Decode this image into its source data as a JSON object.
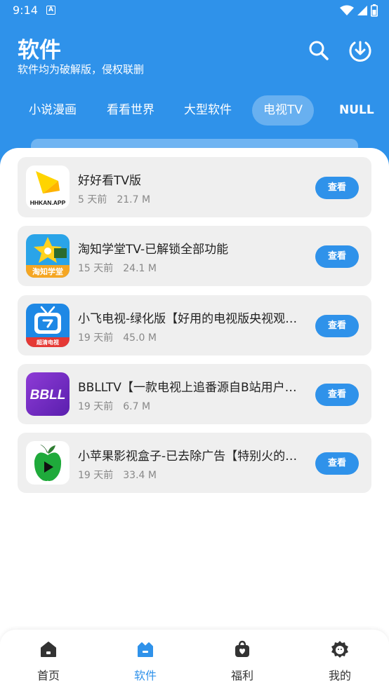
{
  "status_bar": {
    "time": "9:14",
    "badge": "A"
  },
  "header": {
    "title": "软件",
    "subtitle": "软件均为破解版，侵权联删"
  },
  "tabs": [
    {
      "label": "小说漫画"
    },
    {
      "label": "看看世界"
    },
    {
      "label": "大型软件"
    },
    {
      "label": "电视TV",
      "active": true
    },
    {
      "label": "NULL"
    }
  ],
  "apps": [
    {
      "name": "好好看TV版",
      "time": "5 天前",
      "size": "21.7 M",
      "button": "查看",
      "icon": "hhkan-app-icon",
      "icon_text": "HHKAN.APP"
    },
    {
      "name": "淘知学堂TV-已解锁全部功能",
      "time": "15 天前",
      "size": "24.1 M",
      "button": "查看",
      "icon": "taozhi-app-icon",
      "icon_text": "淘知学堂"
    },
    {
      "name": "小飞电视-绿化版【好用的电视版央视观看软件】",
      "time": "19 天前",
      "size": "45.0 M",
      "button": "查看",
      "icon": "xiaofei-tv-icon",
      "icon_text": "超清电视"
    },
    {
      "name": "BBLLTV【一款电视上追番源自B站用户自制的软件】",
      "time": "19 天前",
      "size": "6.7 M",
      "button": "查看",
      "icon": "bbll-icon",
      "icon_text": "BBLL"
    },
    {
      "name": "小苹果影视盒子-已去除广告【特别火的影视软件】",
      "time": "19 天前",
      "size": "33.4 M",
      "button": "查看",
      "icon": "apple-icon"
    }
  ],
  "nav": [
    {
      "label": "首页",
      "icon": "home-icon"
    },
    {
      "label": "软件",
      "icon": "software-icon",
      "active": true
    },
    {
      "label": "福利",
      "icon": "bag-icon"
    },
    {
      "label": "我的",
      "icon": "profile-icon"
    }
  ],
  "colors": {
    "primary": "#2f92ea",
    "card": "#efefef"
  }
}
